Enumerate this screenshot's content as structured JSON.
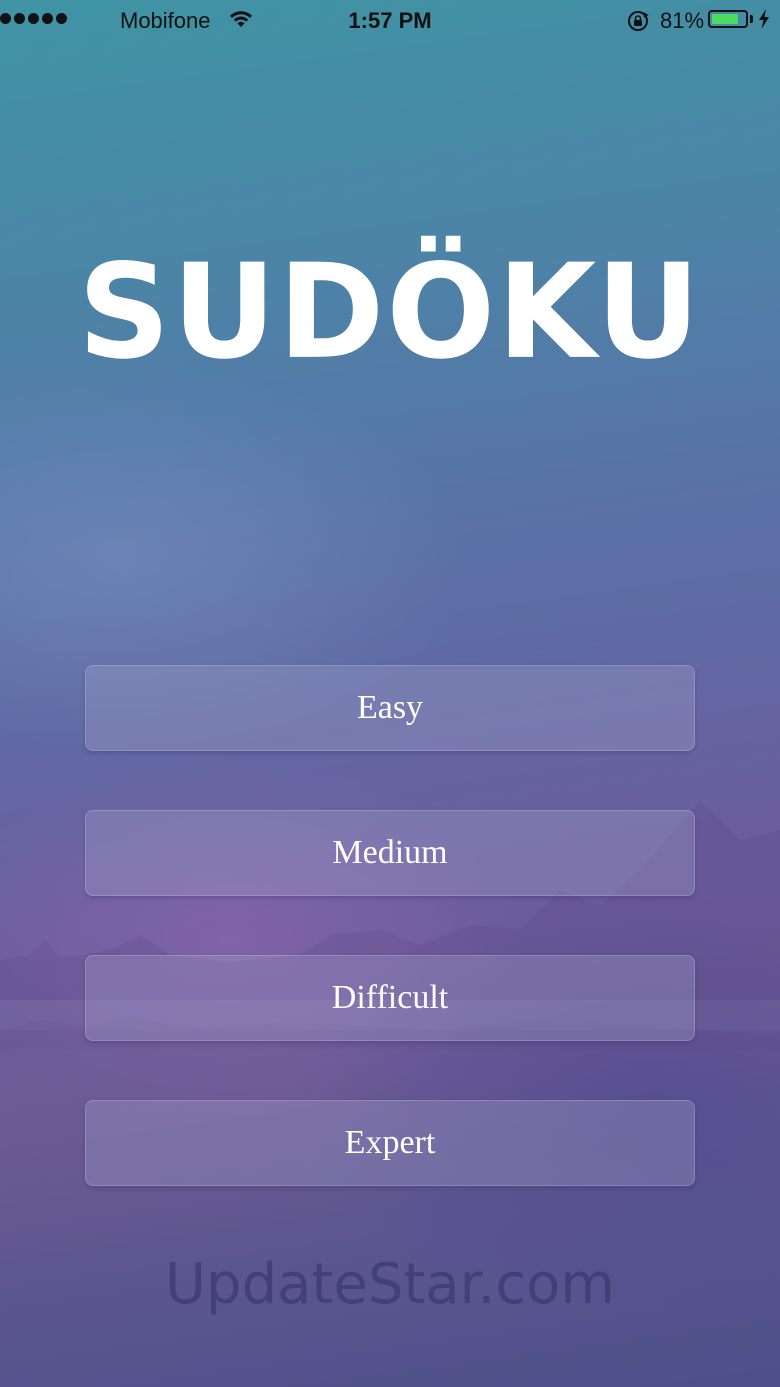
{
  "status_bar": {
    "carrier": "Mobifone",
    "time": "1:57 PM",
    "battery_percent": "81%",
    "battery_level": 0.81,
    "icons": [
      "signal-dots-icon",
      "wifi-icon",
      "orientation-lock-icon",
      "battery-icon",
      "charging-bolt-icon"
    ]
  },
  "app": {
    "title": "SUDÖKU"
  },
  "menu": {
    "items": [
      {
        "label": "Easy"
      },
      {
        "label": "Medium"
      },
      {
        "label": "Difficult"
      },
      {
        "label": "Expert"
      }
    ]
  },
  "watermark": {
    "text": "UpdateStar.com"
  },
  "colors": {
    "title_text": "#ffffff",
    "button_text": "#ffffff",
    "battery_fill": "#4cd964",
    "background_top": "#3f94a4",
    "background_bottom": "#4e5089"
  }
}
